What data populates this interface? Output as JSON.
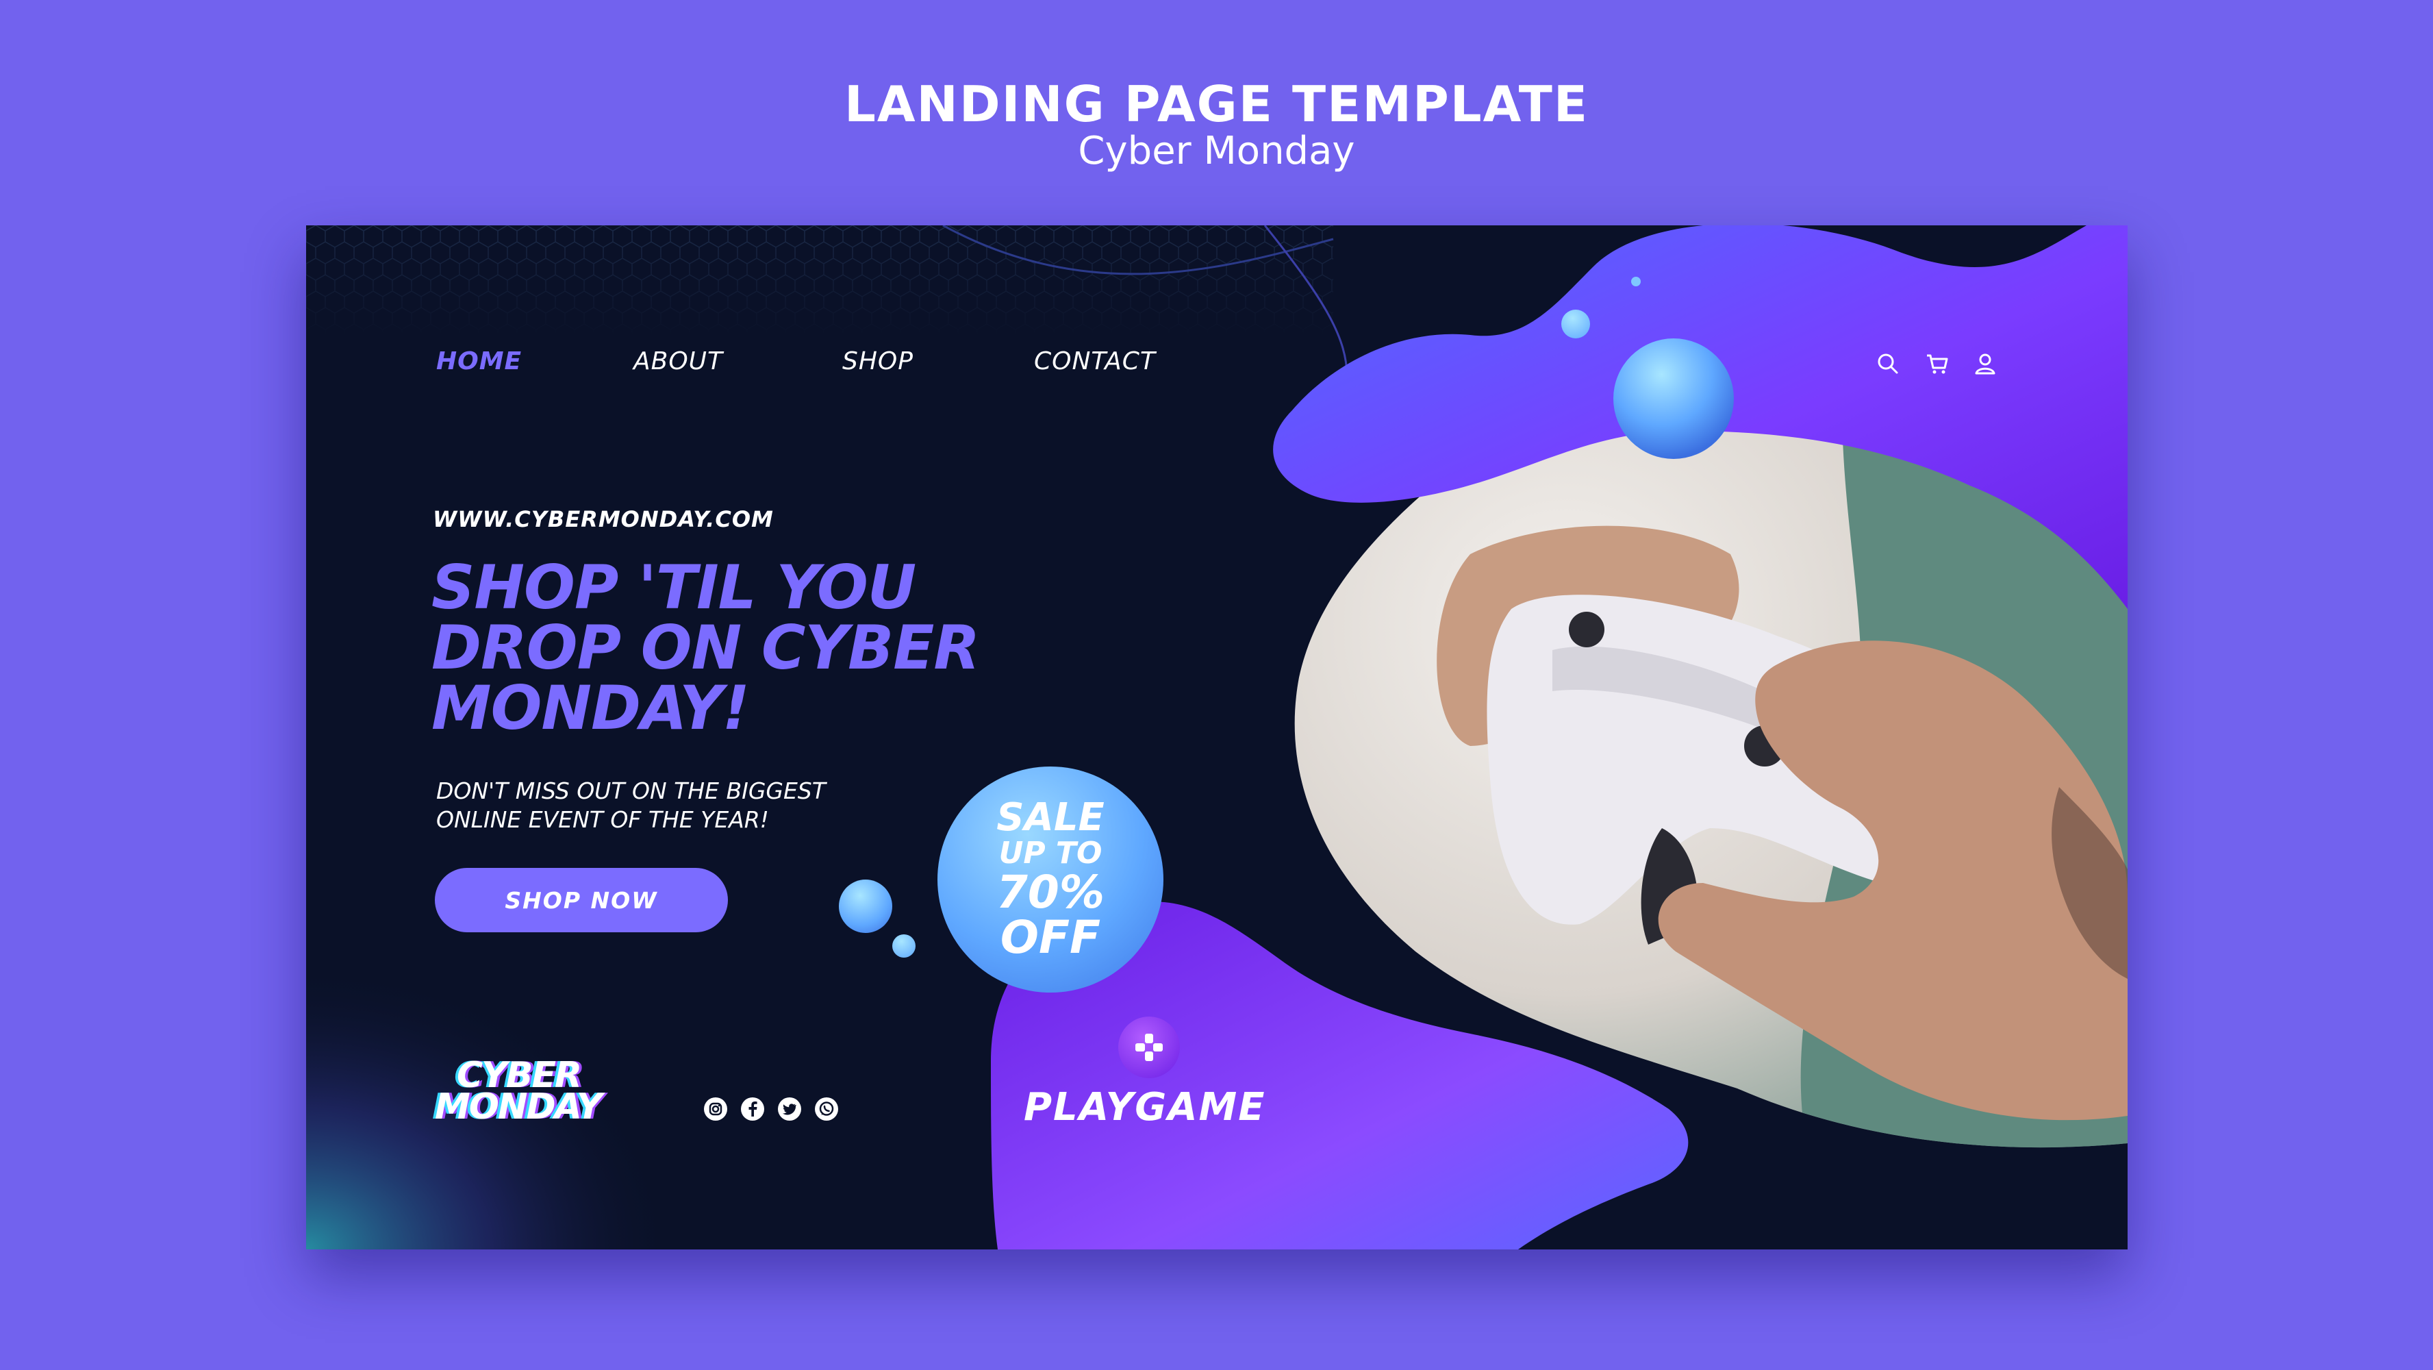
{
  "page_header": {
    "title": "LANDING PAGE TEMPLATE",
    "subtitle": "Cyber Monday"
  },
  "nav": {
    "items": [
      {
        "label": "HOME",
        "active": true
      },
      {
        "label": "ABOUT",
        "active": false
      },
      {
        "label": "SHOP",
        "active": false
      },
      {
        "label": "CONTACT",
        "active": false
      }
    ],
    "icons": [
      "search-icon",
      "cart-icon",
      "user-icon"
    ]
  },
  "hero": {
    "url": "WWW.CYBERMONDAY.COM",
    "headline_lines": [
      "SHOP 'TIL YOU",
      "DROP ON CYBER",
      "MONDAY!"
    ],
    "subtext_lines": [
      "DON'T MISS OUT ON THE BIGGEST",
      "ONLINE EVENT OF THE YEAR!"
    ],
    "cta_label": "SHOP NOW"
  },
  "sale_badge": {
    "line1": "SALE",
    "line2": "UP TO",
    "line3": "70%",
    "line4": "OFF"
  },
  "footer": {
    "logo_lines": [
      "CYBER",
      "MONDAY"
    ],
    "social_icons": [
      "instagram-icon",
      "facebook-icon",
      "twitter-icon",
      "whatsapp-icon"
    ],
    "playgame_label": "PLAYGAME",
    "playgame_icon": "gamepad-icon"
  },
  "colors": {
    "page_background": "#7262ee",
    "card_background": "#0a1128",
    "accent": "#7b6cff",
    "blob_purple": "#6f2bff",
    "bubble_blue": "#5fa8ff"
  }
}
